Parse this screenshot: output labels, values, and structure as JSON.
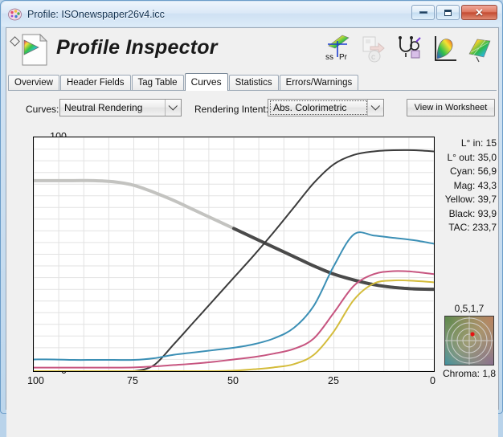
{
  "window": {
    "title": "Profile: ISOnewspaper26v4.icc",
    "icon": "palette-icon",
    "buttons": {
      "minimize": "minimize-button",
      "maximize": "maximize-button",
      "close": "close-button"
    }
  },
  "header": {
    "app_title": "Profile Inspector",
    "doc_icon": "profile-document-icon",
    "expander_icon": "diamond-expander-icon",
    "tools": [
      {
        "name": "ss-pr-icon",
        "label": "ssPr",
        "dim": false
      },
      {
        "name": "profile-convert-icon",
        "label": "",
        "dim": true
      },
      {
        "name": "stethoscope-inspect-icon",
        "label": "",
        "dim": false
      },
      {
        "name": "gamut-plot-icon",
        "label": "",
        "dim": false
      },
      {
        "name": "gamut-3d-icon",
        "label": "",
        "dim": false
      }
    ]
  },
  "tabs": [
    {
      "label": "Overview",
      "active": false
    },
    {
      "label": "Header Fields",
      "active": false
    },
    {
      "label": "Tag Table",
      "active": false
    },
    {
      "label": "Curves",
      "active": true
    },
    {
      "label": "Statistics",
      "active": false
    },
    {
      "label": "Errors/Warnings",
      "active": false
    }
  ],
  "controls": {
    "curves_label": "Curves:",
    "curves_value": "Neutral Rendering",
    "intent_label": "Rendering Intent:",
    "intent_value": "Abs. Colorimetric",
    "worksheet_button": "View in Worksheet"
  },
  "readout": [
    {
      "key": "L° in:",
      "value": "15",
      "text": "L° in: 15"
    },
    {
      "key": "L° out:",
      "value": "35,0",
      "text": "L° out: 35,0"
    },
    {
      "key": "Cyan:",
      "value": "56,9",
      "text": "Cyan: 56,9"
    },
    {
      "key": "Mag:",
      "value": "43,3",
      "text": "Mag: 43,3"
    },
    {
      "key": "Yellow:",
      "value": "39,7",
      "text": "Yellow: 39,7"
    },
    {
      "key": "Black:",
      "value": "93,9",
      "text": "Black: 93,9"
    },
    {
      "key": "TAC:",
      "value": "233,7",
      "text": "TAC: 233,7"
    }
  ],
  "chroma_widget": {
    "caption": "0,5,1,7",
    "footer": "Chroma: 1,8",
    "marker_color": "#e81010"
  },
  "chart_data": {
    "type": "line",
    "title": "",
    "xlabel": "",
    "ylabel": "",
    "xlim": [
      100,
      0
    ],
    "ylim": [
      0,
      100
    ],
    "x_ticks": [
      100,
      75,
      50,
      25,
      0
    ],
    "y_ticks": [
      0,
      25,
      50,
      75,
      100
    ],
    "x_reversed": true,
    "grid": true,
    "legend": "none",
    "x": [
      100,
      95,
      90,
      85,
      80,
      75,
      70,
      65,
      60,
      55,
      50,
      45,
      40,
      35,
      30,
      25,
      20,
      15,
      10,
      5,
      0
    ],
    "series": [
      {
        "name": "L* out (light gray)",
        "color": "#c3c3c0",
        "width": 4,
        "values": [
          81.5,
          81.5,
          81.5,
          81.5,
          81.0,
          79.5,
          76.5,
          73.0,
          69.0,
          65.0,
          61.0,
          57.0,
          53.0,
          49.0,
          45.0,
          41.5,
          39.0,
          37.0,
          35.8,
          35.2,
          35.0
        ]
      },
      {
        "name": "L* out (dark gray)",
        "color": "#4a4a4a",
        "width": 4,
        "values": [
          null,
          null,
          null,
          null,
          null,
          null,
          null,
          null,
          null,
          null,
          61.0,
          57.0,
          53.0,
          49.0,
          45.0,
          41.5,
          39.0,
          37.0,
          35.8,
          35.2,
          35.0
        ]
      },
      {
        "name": "Black",
        "color": "#3b3b3b",
        "width": 2,
        "values": [
          0,
          0,
          0,
          0,
          0,
          0,
          2.5,
          11.5,
          21.0,
          30.5,
          40.0,
          49.5,
          59.5,
          70.0,
          80.5,
          88.5,
          92.5,
          94.0,
          94.5,
          94.5,
          94.0
        ]
      },
      {
        "name": "Cyan",
        "color": "#3b8fb5",
        "width": 2,
        "values": [
          5.0,
          5.0,
          4.8,
          4.8,
          4.8,
          4.8,
          5.5,
          7.0,
          8.0,
          9.0,
          10.0,
          11.5,
          14.0,
          18.5,
          28.0,
          45.0,
          58.5,
          58.0,
          57.0,
          56.0,
          54.5
        ]
      },
      {
        "name": "Magenta",
        "color": "#c75580",
        "width": 2,
        "values": [
          1.5,
          1.5,
          1.5,
          1.5,
          1.5,
          1.6,
          2.0,
          2.6,
          3.2,
          4.0,
          5.0,
          6.0,
          7.5,
          9.5,
          14.0,
          25.0,
          36.5,
          41.5,
          42.8,
          42.5,
          41.5
        ]
      },
      {
        "name": "Yellow",
        "color": "#d4bc3b",
        "width": 2,
        "values": [
          0,
          0,
          0,
          0,
          0,
          0,
          0,
          0,
          0,
          0,
          0.2,
          0.8,
          1.6,
          3.0,
          7.0,
          17.0,
          30.5,
          37.5,
          38.8,
          38.6,
          38.0
        ]
      }
    ]
  }
}
